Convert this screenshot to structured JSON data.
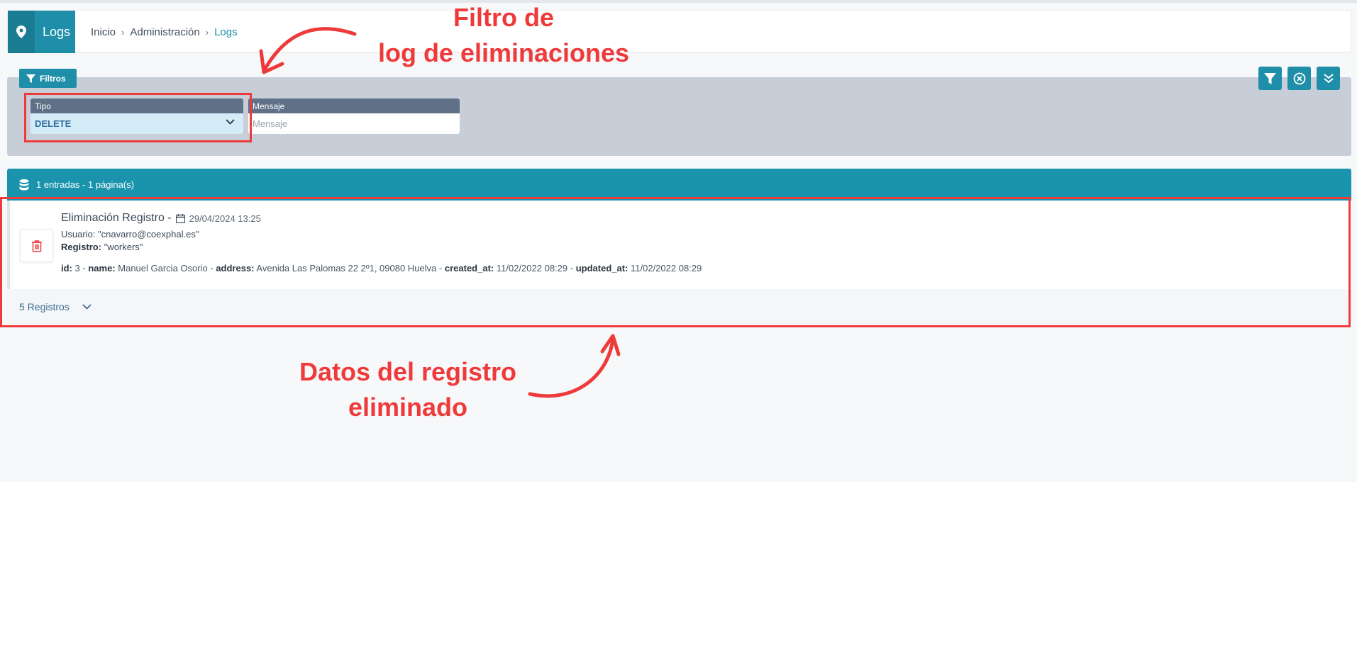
{
  "header": {
    "section_title": "Logs",
    "breadcrumbs": [
      {
        "label": "Inicio"
      },
      {
        "label": "Administración"
      },
      {
        "label": "Logs"
      }
    ]
  },
  "filters": {
    "button_label": "Filtros",
    "tipo": {
      "label": "Tipo",
      "value": "DELETE"
    },
    "mensaje": {
      "label": "Mensaje",
      "placeholder": "Mensaje"
    }
  },
  "results": {
    "summary": "1 entradas - 1 página(s)",
    "entry": {
      "title": "Eliminación Registro -",
      "date": "29/04/2024 13:25",
      "usuario_label": "Usuario:",
      "usuario_value": "\"cnavarro@coexphal.es\"",
      "registro_label": "Registro:",
      "registro_value": "\"workers\"",
      "details": [
        {
          "key": "id:",
          "value": "3"
        },
        {
          "key": "name:",
          "value": "Manuel Garcia Osorio"
        },
        {
          "key": "address:",
          "value": "Avenida Las Palomas 22 2º1, 09080 Huelva"
        },
        {
          "key": "created_at:",
          "value": "11/02/2022 08:29"
        },
        {
          "key": "updated_at:",
          "value": "11/02/2022 08:29"
        }
      ],
      "separator": "-"
    },
    "records_toggle": "5 Registros"
  },
  "annotations": {
    "filter_note_line1": "Filtro de",
    "filter_note_line2": "log de eliminaciones",
    "data_note_line1": "Datos del registro",
    "data_note_line2": "eliminado"
  },
  "colors": {
    "primary": "#1f8fa9",
    "annotation": "#ee3a3a"
  }
}
